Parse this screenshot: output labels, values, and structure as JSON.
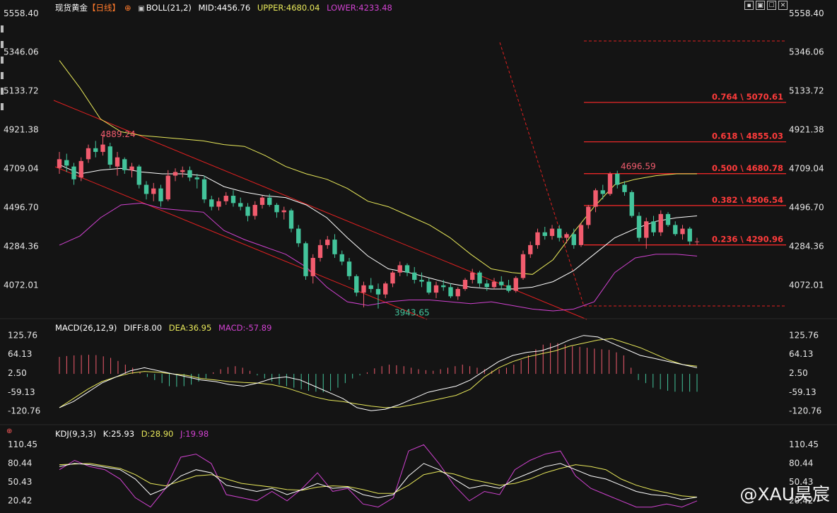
{
  "header": {
    "symbol": "现货黄金",
    "period": "【日线】",
    "boll_name": "BOLL(21,2)",
    "boll_mid": "MID:4456.76",
    "boll_upper": "UPPER:4680.04",
    "boll_lower": "LOWER:4233.48"
  },
  "toolbar": {
    "btn1": "▪",
    "btn2": "▣",
    "btn3": "☐",
    "btn4": "✕"
  },
  "macd_header": {
    "name": "MACD(26,12,9)",
    "diff": "DIFF:8.00",
    "dea": "DEA:36.95",
    "macd": "MACD:-57.89"
  },
  "kdj_header": {
    "name": "KDJ(9,3,3)",
    "k": "K:25.93",
    "d": "D:28.90",
    "j": "J:19.98"
  },
  "watermark": "@XAU昊宸",
  "colors": {
    "up": "#f25c6e",
    "down": "#43c49b",
    "upper": "#e8e85a",
    "mid": "#ffffff",
    "lower": "#d042d0",
    "fib": "#ff2a2a",
    "bg": "#141414"
  },
  "chart_data": [
    {
      "type": "candlestick",
      "title": "现货黄金【日线】",
      "y_ticks": [
        "5558.40",
        "5346.06",
        "5133.72",
        "4921.38",
        "4709.04",
        "4496.70",
        "4284.36",
        "4072.01"
      ],
      "ylim": [
        3930,
        5600
      ],
      "candles": [
        {
          "o": 4712,
          "h": 4800,
          "l": 4680,
          "c": 4760
        },
        {
          "o": 4755,
          "h": 4790,
          "l": 4690,
          "c": 4725
        },
        {
          "o": 4720,
          "h": 4740,
          "l": 4620,
          "c": 4650
        },
        {
          "o": 4660,
          "h": 4770,
          "l": 4640,
          "c": 4750
        },
        {
          "o": 4760,
          "h": 4840,
          "l": 4740,
          "c": 4820
        },
        {
          "o": 4820,
          "h": 4860,
          "l": 4770,
          "c": 4800
        },
        {
          "o": 4800,
          "h": 4889,
          "l": 4780,
          "c": 4840
        },
        {
          "o": 4830,
          "h": 4850,
          "l": 4710,
          "c": 4730
        },
        {
          "o": 4720,
          "h": 4800,
          "l": 4670,
          "c": 4770
        },
        {
          "o": 4760,
          "h": 4770,
          "l": 4680,
          "c": 4700
        },
        {
          "o": 4700,
          "h": 4740,
          "l": 4660,
          "c": 4720
        },
        {
          "o": 4720,
          "h": 4730,
          "l": 4600,
          "c": 4620
        },
        {
          "o": 4620,
          "h": 4640,
          "l": 4540,
          "c": 4570
        },
        {
          "o": 4570,
          "h": 4630,
          "l": 4530,
          "c": 4600
        },
        {
          "o": 4600,
          "h": 4620,
          "l": 4500,
          "c": 4530
        },
        {
          "o": 4540,
          "h": 4700,
          "l": 4530,
          "c": 4670
        },
        {
          "o": 4670,
          "h": 4710,
          "l": 4640,
          "c": 4690
        },
        {
          "o": 4690,
          "h": 4720,
          "l": 4660,
          "c": 4700
        },
        {
          "o": 4700,
          "h": 4720,
          "l": 4640,
          "c": 4660
        },
        {
          "o": 4660,
          "h": 4680,
          "l": 4600,
          "c": 4650
        },
        {
          "o": 4650,
          "h": 4670,
          "l": 4520,
          "c": 4540
        },
        {
          "o": 4540,
          "h": 4560,
          "l": 4480,
          "c": 4500
        },
        {
          "o": 4500,
          "h": 4550,
          "l": 4480,
          "c": 4530
        },
        {
          "o": 4530,
          "h": 4580,
          "l": 4510,
          "c": 4560
        },
        {
          "o": 4560,
          "h": 4590,
          "l": 4500,
          "c": 4520
        },
        {
          "o": 4520,
          "h": 4550,
          "l": 4480,
          "c": 4500
        },
        {
          "o": 4500,
          "h": 4520,
          "l": 4420,
          "c": 4450
        },
        {
          "o": 4450,
          "h": 4530,
          "l": 4430,
          "c": 4510
        },
        {
          "o": 4510,
          "h": 4560,
          "l": 4490,
          "c": 4550
        },
        {
          "o": 4550,
          "h": 4570,
          "l": 4500,
          "c": 4510
        },
        {
          "o": 4510,
          "h": 4520,
          "l": 4440,
          "c": 4470
        },
        {
          "o": 4470,
          "h": 4500,
          "l": 4430,
          "c": 4480
        },
        {
          "o": 4480,
          "h": 4490,
          "l": 4360,
          "c": 4380
        },
        {
          "o": 4380,
          "h": 4400,
          "l": 4280,
          "c": 4300
        },
        {
          "o": 4300,
          "h": 4310,
          "l": 4100,
          "c": 4120
        },
        {
          "o": 4120,
          "h": 4240,
          "l": 4080,
          "c": 4220
        },
        {
          "o": 4220,
          "h": 4320,
          "l": 4200,
          "c": 4290
        },
        {
          "o": 4290,
          "h": 4340,
          "l": 4270,
          "c": 4320
        },
        {
          "o": 4320,
          "h": 4350,
          "l": 4220,
          "c": 4240
        },
        {
          "o": 4240,
          "h": 4260,
          "l": 4180,
          "c": 4200
        },
        {
          "o": 4200,
          "h": 4220,
          "l": 4100,
          "c": 4120
        },
        {
          "o": 4120,
          "h": 4130,
          "l": 4010,
          "c": 4030
        },
        {
          "o": 4030,
          "h": 4090,
          "l": 3950,
          "c": 4070
        },
        {
          "o": 4070,
          "h": 4110,
          "l": 4030,
          "c": 4050
        },
        {
          "o": 4050,
          "h": 4080,
          "l": 3943,
          "c": 4020
        },
        {
          "o": 4020,
          "h": 4090,
          "l": 4000,
          "c": 4080
        },
        {
          "o": 4080,
          "h": 4150,
          "l": 4060,
          "c": 4140
        },
        {
          "o": 4140,
          "h": 4200,
          "l": 4120,
          "c": 4180
        },
        {
          "o": 4180,
          "h": 4190,
          "l": 4120,
          "c": 4140
        },
        {
          "o": 4140,
          "h": 4170,
          "l": 4080,
          "c": 4100
        },
        {
          "o": 4100,
          "h": 4140,
          "l": 4060,
          "c": 4090
        },
        {
          "o": 4090,
          "h": 4110,
          "l": 4020,
          "c": 4030
        },
        {
          "o": 4030,
          "h": 4090,
          "l": 4000,
          "c": 4070
        },
        {
          "o": 4070,
          "h": 4100,
          "l": 4040,
          "c": 4060
        },
        {
          "o": 4060,
          "h": 4080,
          "l": 4000,
          "c": 4010
        },
        {
          "o": 4010,
          "h": 4060,
          "l": 3990,
          "c": 4050
        },
        {
          "o": 4050,
          "h": 4110,
          "l": 4040,
          "c": 4100
        },
        {
          "o": 4100,
          "h": 4160,
          "l": 4080,
          "c": 4140
        },
        {
          "o": 4140,
          "h": 4150,
          "l": 4060,
          "c": 4080
        },
        {
          "o": 4080,
          "h": 4100,
          "l": 4040,
          "c": 4060
        },
        {
          "o": 4060,
          "h": 4110,
          "l": 4050,
          "c": 4090
        },
        {
          "o": 4090,
          "h": 4120,
          "l": 4050,
          "c": 4070
        },
        {
          "o": 4070,
          "h": 4100,
          "l": 4030,
          "c": 4040
        },
        {
          "o": 4040,
          "h": 4120,
          "l": 4030,
          "c": 4110
        },
        {
          "o": 4110,
          "h": 4260,
          "l": 4100,
          "c": 4240
        },
        {
          "o": 4240,
          "h": 4310,
          "l": 4220,
          "c": 4290
        },
        {
          "o": 4290,
          "h": 4380,
          "l": 4270,
          "c": 4360
        },
        {
          "o": 4360,
          "h": 4390,
          "l": 4320,
          "c": 4340
        },
        {
          "o": 4340,
          "h": 4400,
          "l": 4320,
          "c": 4380
        },
        {
          "o": 4380,
          "h": 4400,
          "l": 4310,
          "c": 4330
        },
        {
          "o": 4330,
          "h": 4360,
          "l": 4300,
          "c": 4350
        },
        {
          "o": 4350,
          "h": 4380,
          "l": 4270,
          "c": 4290
        },
        {
          "o": 4290,
          "h": 4410,
          "l": 4280,
          "c": 4400
        },
        {
          "o": 4400,
          "h": 4510,
          "l": 4380,
          "c": 4500
        },
        {
          "o": 4500,
          "h": 4600,
          "l": 4470,
          "c": 4590
        },
        {
          "o": 4590,
          "h": 4620,
          "l": 4540,
          "c": 4570
        },
        {
          "o": 4570,
          "h": 4690,
          "l": 4560,
          "c": 4680
        },
        {
          "o": 4680,
          "h": 4697,
          "l": 4600,
          "c": 4620
        },
        {
          "o": 4620,
          "h": 4640,
          "l": 4560,
          "c": 4580
        },
        {
          "o": 4580,
          "h": 4590,
          "l": 4440,
          "c": 4450
        },
        {
          "o": 4450,
          "h": 4470,
          "l": 4310,
          "c": 4330
        },
        {
          "o": 4330,
          "h": 4440,
          "l": 4270,
          "c": 4420
        },
        {
          "o": 4420,
          "h": 4450,
          "l": 4340,
          "c": 4360
        },
        {
          "o": 4360,
          "h": 4480,
          "l": 4340,
          "c": 4460
        },
        {
          "o": 4460,
          "h": 4470,
          "l": 4390,
          "c": 4400
        },
        {
          "o": 4400,
          "h": 4420,
          "l": 4340,
          "c": 4350
        },
        {
          "o": 4350,
          "h": 4400,
          "l": 4320,
          "c": 4380
        },
        {
          "o": 4380,
          "h": 4390,
          "l": 4290,
          "c": 4310
        },
        {
          "o": 4310,
          "h": 4330,
          "l": 4290,
          "c": 4310
        }
      ],
      "bollinger": {
        "upper": [
          5300,
          5150,
          4980,
          4910,
          4890,
          4880,
          4870,
          4860,
          4840,
          4830,
          4780,
          4720,
          4680,
          4650,
          4600,
          4530,
          4500,
          4450,
          4400,
          4330,
          4240,
          4160,
          4140,
          4130,
          4210,
          4360,
          4500,
          4620,
          4650,
          4670,
          4680,
          4680
        ],
        "mid": [
          4730,
          4680,
          4700,
          4710,
          4690,
          4680,
          4680,
          4670,
          4610,
          4580,
          4560,
          4550,
          4510,
          4440,
          4330,
          4230,
          4160,
          4140,
          4110,
          4080,
          4060,
          4050,
          4050,
          4060,
          4090,
          4150,
          4240,
          4330,
          4380,
          4420,
          4440,
          4450
        ],
        "lower": [
          4290,
          4340,
          4440,
          4510,
          4520,
          4490,
          4480,
          4470,
          4370,
          4320,
          4280,
          4240,
          4170,
          4060,
          3980,
          3960,
          3980,
          3990,
          3990,
          3980,
          3970,
          3980,
          3960,
          3940,
          3930,
          3940,
          3980,
          4140,
          4220,
          4240,
          4240,
          4230
        ]
      },
      "fibonacci": [
        {
          "label": "0.764 \\ 5070.61",
          "price": 5070.61
        },
        {
          "label": "0.618 \\ 4855.03",
          "price": 4855.03
        },
        {
          "label": "0.500 \\ 4680.78",
          "price": 4680.78
        },
        {
          "label": "0.382 \\ 4506.54",
          "price": 4506.54
        },
        {
          "label": "0.236 \\ 4290.96",
          "price": 4290.96
        }
      ],
      "annotations": {
        "high": "4889.24",
        "low": "3943.65",
        "recent_high": "4696.59"
      }
    },
    {
      "type": "macd",
      "title": "MACD(26,12,9)",
      "y_ticks": [
        "125.76",
        "64.13",
        "2.50",
        "-59.13",
        "-120.76"
      ],
      "ylim": [
        -140,
        145
      ],
      "hist": [
        55,
        58,
        60,
        61,
        62,
        61,
        57,
        52,
        42,
        30,
        20,
        5,
        -10,
        -20,
        -30,
        -40,
        -42,
        -40,
        -35,
        -25,
        -15,
        5,
        15,
        22,
        25,
        20,
        10,
        -5,
        -15,
        -25,
        -35,
        -40,
        -45,
        -50,
        -55,
        -58,
        -60,
        -55,
        -45,
        -30,
        -15,
        -5,
        5,
        18,
        25,
        30,
        28,
        25,
        20,
        15,
        12,
        10,
        15,
        20,
        25,
        30,
        25,
        20,
        15,
        10,
        15,
        20,
        30,
        45,
        60,
        80,
        95,
        100,
        100,
        95,
        90,
        88,
        85,
        82,
        80,
        78,
        70,
        60,
        20,
        -20,
        -30,
        -45,
        -50,
        -55,
        -58,
        -58,
        -58,
        -58
      ],
      "diff": [
        -110,
        -90,
        -60,
        -30,
        -10,
        10,
        20,
        10,
        0,
        -10,
        -20,
        -25,
        -35,
        -40,
        -30,
        -15,
        -10,
        -20,
        -40,
        -60,
        -80,
        -110,
        -120,
        -115,
        -100,
        -80,
        -60,
        -50,
        -40,
        -20,
        10,
        40,
        60,
        70,
        75,
        90,
        110,
        125,
        120,
        100,
        80,
        60,
        50,
        40,
        30,
        20
      ],
      "dea": [
        -110,
        -80,
        -50,
        -25,
        -10,
        2,
        8,
        5,
        0,
        -5,
        -15,
        -20,
        -25,
        -28,
        -30,
        -35,
        -45,
        -60,
        -75,
        -85,
        -90,
        -98,
        -105,
        -110,
        -108,
        -100,
        -90,
        -80,
        -70,
        -50,
        -10,
        20,
        40,
        55,
        65,
        75,
        90,
        100,
        110,
        115,
        100,
        85,
        65,
        45,
        30,
        25
      ]
    },
    {
      "type": "kdj",
      "title": "KDJ(9,3,3)",
      "y_ticks": [
        "110.45",
        "80.44",
        "50.43",
        "20.42"
      ],
      "ylim": [
        5,
        115
      ],
      "k": [
        75,
        80,
        78,
        74,
        70,
        55,
        30,
        40,
        60,
        70,
        65,
        45,
        40,
        35,
        40,
        30,
        38,
        48,
        40,
        42,
        30,
        25,
        30,
        60,
        80,
        70,
        55,
        40,
        45,
        40,
        55,
        65,
        75,
        80,
        70,
        60,
        55,
        45,
        35,
        30,
        28,
        22,
        26
      ],
      "d": [
        78,
        79,
        80,
        76,
        72,
        62,
        48,
        44,
        52,
        60,
        62,
        55,
        48,
        45,
        42,
        38,
        37,
        42,
        44,
        43,
        38,
        32,
        32,
        45,
        62,
        67,
        63,
        55,
        50,
        45,
        48,
        55,
        65,
        72,
        78,
        75,
        70,
        55,
        45,
        38,
        33,
        28,
        26
      ],
      "j": [
        70,
        85,
        75,
        70,
        55,
        25,
        10,
        40,
        90,
        95,
        80,
        30,
        25,
        20,
        35,
        20,
        40,
        65,
        35,
        40,
        15,
        10,
        25,
        100,
        110,
        80,
        45,
        20,
        35,
        30,
        70,
        85,
        95,
        100,
        60,
        40,
        30,
        20,
        10,
        10,
        15,
        10,
        20
      ]
    }
  ]
}
